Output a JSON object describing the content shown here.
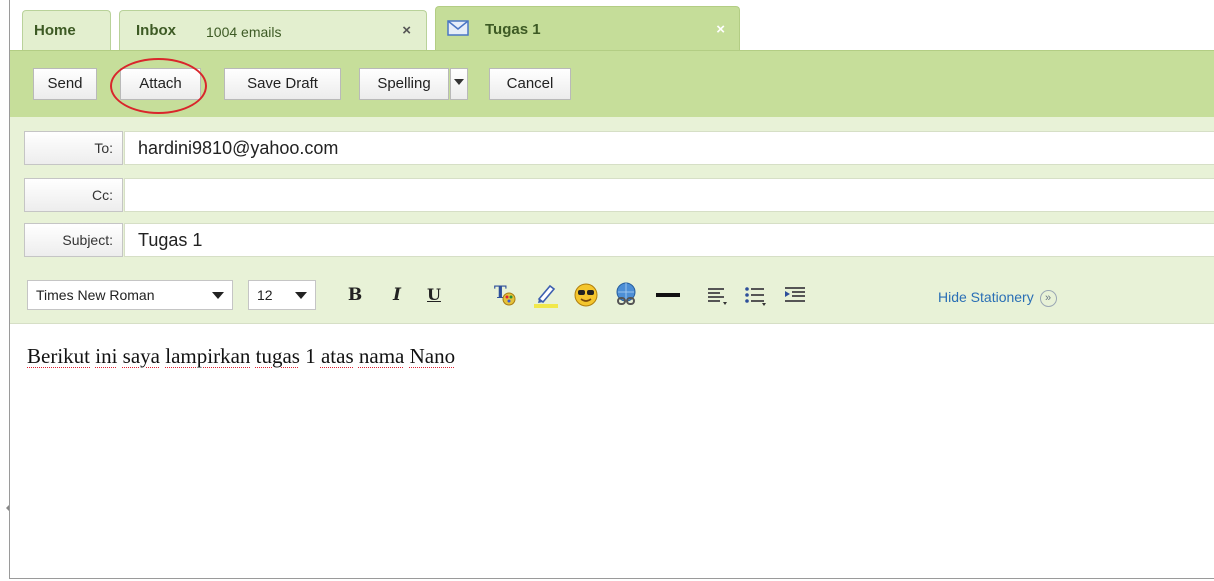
{
  "tabs": {
    "home": {
      "label": "Home"
    },
    "inbox": {
      "label": "Inbox",
      "count": "1004 emails",
      "close": "×"
    },
    "compose": {
      "label": "Tugas 1",
      "close": "×",
      "icon": "envelope-icon"
    }
  },
  "toolbar": {
    "send_label": "Send",
    "attach_label": "Attach",
    "save_draft_label": "Save Draft",
    "spelling_label": "Spelling",
    "cancel_label": "Cancel",
    "highlight_color": "#d9262b"
  },
  "fields": {
    "to": {
      "label": "To:",
      "value": "hardini9810@yahoo.com"
    },
    "cc": {
      "label": "Cc:",
      "value": ""
    },
    "subject": {
      "label": "Subject:",
      "value": "Tugas 1"
    }
  },
  "format_bar": {
    "font_family": "Times New Roman",
    "font_size": "12",
    "bold": "B",
    "italic": "I",
    "underline": "U",
    "icons": [
      "text-color-icon",
      "highlight-icon",
      "emoticon-icon",
      "insert-link-icon",
      "horizontal-rule-icon",
      "align-icon",
      "bullet-list-icon",
      "indent-icon"
    ],
    "hide_stationery_label": "Hide Stationery",
    "hide_stationery_glyph": "»"
  },
  "body": {
    "words": [
      "Berikut",
      "ini",
      "saya",
      "lampirkan",
      "tugas",
      "1",
      "atas",
      "nama",
      "Nano"
    ]
  },
  "colors": {
    "tab_active": "#c5dd99",
    "toolbar": "#c6de9a",
    "header": "#e8f2d7",
    "link": "#2a6fb5"
  }
}
